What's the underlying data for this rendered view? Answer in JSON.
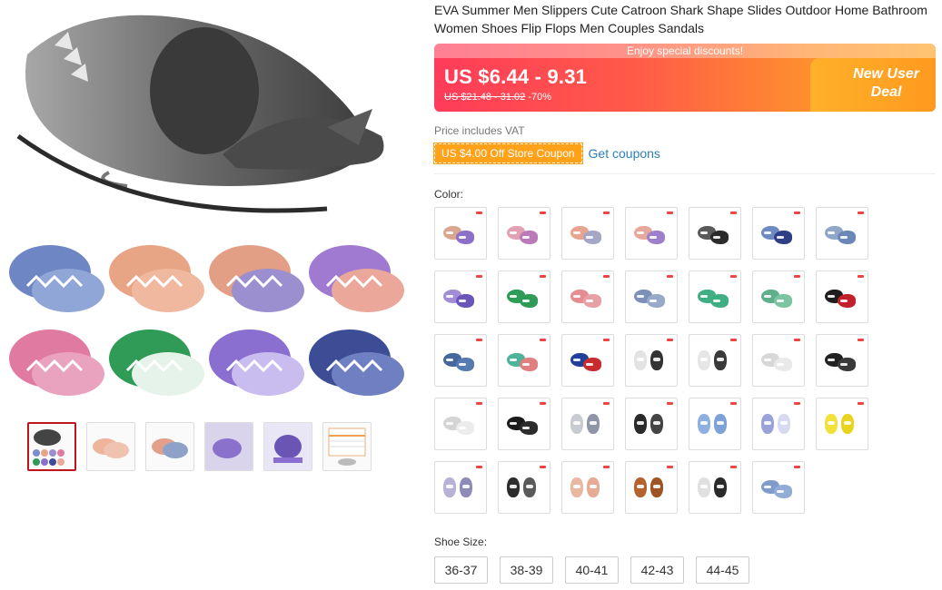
{
  "product": {
    "title": "EVA Summer Men Slippers Cute Catroon Shark Shape Slides Outdoor Home Bathroom Women Shoes Flip Flops Men Couples Sandals"
  },
  "price_banner": {
    "ribbon": "Enjoy special discounts!",
    "price": "US $6.44 - 9.31",
    "original_price": "US $21.48 - 31.02",
    "discount": "-70%",
    "deal_line1": "New User",
    "deal_line2": "Deal"
  },
  "vat_note": "Price includes VAT",
  "coupon": {
    "badge": "US $4.00 Off Store Coupon",
    "link": "Get coupons"
  },
  "color": {
    "label": "Color:",
    "swatches": [
      {
        "c1": "#d9a78f",
        "c2": "#8c6fc7",
        "style": "flat"
      },
      {
        "c1": "#e1a0b4",
        "c2": "#b97ab7",
        "style": "flat"
      },
      {
        "c1": "#e7a58f",
        "c2": "#a6a6c6",
        "style": "flat"
      },
      {
        "c1": "#e6a89a",
        "c2": "#9d80c9",
        "style": "flat"
      },
      {
        "c1": "#5a5a5a",
        "c2": "#2b2b2b",
        "style": "flat"
      },
      {
        "c1": "#6d8ac2",
        "c2": "#2f3f86",
        "style": "flat"
      },
      {
        "c1": "#8fa6c9",
        "c2": "#6b87b8",
        "style": "flat"
      },
      {
        "c1": "#a08dd6",
        "c2": "#6a56b9",
        "style": "flat"
      },
      {
        "c1": "#2e9b57",
        "c2": "#2e9b57",
        "style": "flat"
      },
      {
        "c1": "#e88c93",
        "c2": "#e7a0a5",
        "style": "flat"
      },
      {
        "c1": "#7f90b8",
        "c2": "#99a9c9",
        "style": "flat"
      },
      {
        "c1": "#3fae82",
        "c2": "#3fae82",
        "style": "flat"
      },
      {
        "c1": "#5fb08a",
        "c2": "#7cc5a3",
        "style": "flat"
      },
      {
        "c1": "#1e1e1e",
        "c2": "#c2202a",
        "style": "flat"
      },
      {
        "c1": "#46679b",
        "c2": "#567bb1",
        "style": "flat"
      },
      {
        "c1": "#4fb39a",
        "c2": "#e07f7f",
        "style": "flat"
      },
      {
        "c1": "#223f9a",
        "c2": "#c82c2c",
        "style": "flat"
      },
      {
        "c1": "#e3e3e3",
        "c2": "#333333",
        "style": "upright"
      },
      {
        "c1": "#e6e6e6",
        "c2": "#3a3a3a",
        "style": "upright"
      },
      {
        "c1": "#d7d7d7",
        "c2": "#e9e9e9",
        "style": "flat"
      },
      {
        "c1": "#222222",
        "c2": "#3a3a3a",
        "style": "flat"
      },
      {
        "c1": "#d4d4d4",
        "c2": "#ececec",
        "style": "flat"
      },
      {
        "c1": "#1b1b1b",
        "c2": "#2c2c2c",
        "style": "flat"
      },
      {
        "c1": "#c9cbd2",
        "c2": "#8d95a6",
        "style": "upright"
      },
      {
        "c1": "#2a2a2a",
        "c2": "#444444",
        "style": "upright"
      },
      {
        "c1": "#8eb0e0",
        "c2": "#7da2d8",
        "style": "upright"
      },
      {
        "c1": "#9aa3d8",
        "c2": "#d8daf2",
        "style": "upright"
      },
      {
        "c1": "#f1e23a",
        "c2": "#e8d41c",
        "style": "upright"
      },
      {
        "c1": "#b7b2d6",
        "c2": "#8e8bb8",
        "style": "upright"
      },
      {
        "c1": "#2c2c2c",
        "c2": "#5a5a5a",
        "style": "upright"
      },
      {
        "c1": "#eab8a2",
        "c2": "#e6ab94",
        "style": "upright"
      },
      {
        "c1": "#b4622e",
        "c2": "#9e5424",
        "style": "upright"
      },
      {
        "c1": "#e0e0e0",
        "c2": "#2a2a2a",
        "style": "upright"
      },
      {
        "c1": "#7f9ccc",
        "c2": "#91acd6",
        "style": "flat"
      }
    ]
  },
  "size": {
    "label": "Shoe Size:",
    "options": [
      "36-37",
      "38-39",
      "40-41",
      "42-43",
      "44-45"
    ]
  },
  "colors": {
    "accent_red": "#c0141c",
    "coupon_orange": "#ffa21a",
    "link_blue": "#2e7fb8",
    "banner_start": "#ff3b5a",
    "banner_end": "#ffa526"
  }
}
